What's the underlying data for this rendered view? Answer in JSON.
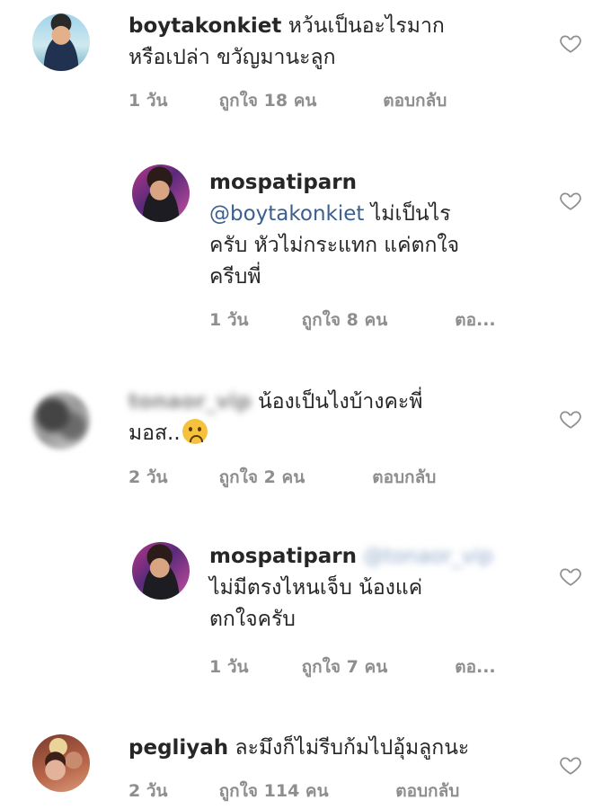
{
  "comments": [
    {
      "username": "boytakonkiet",
      "text_line1": "หว้นเป็นอะไรมาก",
      "text_line2": "หรือเปล่า ขวัญมานะลูก",
      "time": "1 วัน",
      "likes": "ถูกใจ 18 คน",
      "reply": "ตอบกลับ"
    },
    {
      "username": "mospatiparn",
      "mention": "@boytakonkiet",
      "text_line1": "ไม่เป็นไร",
      "text_line2": "ครับ หัวไม่กระแทก แค่ตกใจ",
      "text_line3": "ครีบพี่",
      "time": "1 วัน",
      "likes": "ถูกใจ 8 คน",
      "reply": "ตอ..."
    },
    {
      "username": "tonaor_vip",
      "text_line1": "น้องเป็นไงบ้างคะพี่",
      "text_line2": "มอส..",
      "time": "2 วัน",
      "likes": "ถูกใจ 2 คน",
      "reply": "ตอบกลับ"
    },
    {
      "username": "mospatiparn",
      "mention": "@tonaor_vip",
      "text_line1": "ไม่มีตรงไหนเจ็บ น้องแค่",
      "text_line2": "ตกใจครับ",
      "time": "1 วัน",
      "likes": "ถูกใจ 7 คน",
      "reply": "ตอ..."
    },
    {
      "username": "pegliyah",
      "text_line1": "ละมึงก็ไม่รีบก้มไปอุ้มลูกนะ",
      "time": "2 วัน",
      "likes": "ถูกใจ 114 คน",
      "reply": "ตอบกลับ"
    }
  ],
  "icons": {
    "like": "heart-outline-icon",
    "emoji": "sad-sweat-face-emoji"
  },
  "colors": {
    "text": "#262626",
    "meta": "#8e8e8e",
    "mention": "#3b5f8f"
  }
}
